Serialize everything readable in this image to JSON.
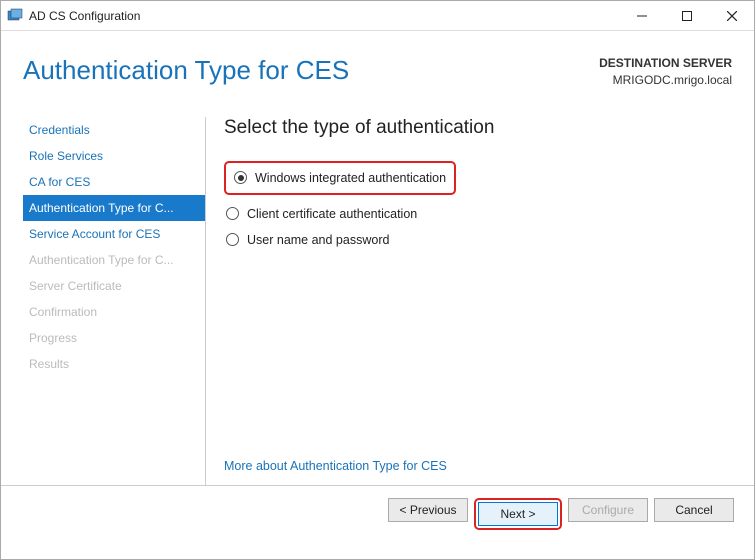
{
  "window": {
    "title": "AD CS Configuration"
  },
  "header": {
    "title": "Authentication Type for CES",
    "dest_label": "DESTINATION SERVER",
    "dest_value": "MRIGODC.mrigo.local"
  },
  "sidebar": {
    "items": [
      {
        "label": "Credentials",
        "state": "link"
      },
      {
        "label": "Role Services",
        "state": "link"
      },
      {
        "label": "CA for CES",
        "state": "link"
      },
      {
        "label": "Authentication Type for C...",
        "state": "selected"
      },
      {
        "label": "Service Account for CES",
        "state": "link"
      },
      {
        "label": "Authentication Type for C...",
        "state": "disabled"
      },
      {
        "label": "Server Certificate",
        "state": "disabled"
      },
      {
        "label": "Confirmation",
        "state": "disabled"
      },
      {
        "label": "Progress",
        "state": "disabled"
      },
      {
        "label": "Results",
        "state": "disabled"
      }
    ]
  },
  "content": {
    "heading": "Select the type of authentication",
    "options": [
      {
        "label": "Windows integrated authentication",
        "checked": true
      },
      {
        "label": "Client certificate authentication",
        "checked": false
      },
      {
        "label": "User name and password",
        "checked": false
      }
    ],
    "more_link": "More about Authentication Type for CES"
  },
  "footer": {
    "previous": "< Previous",
    "next": "Next >",
    "configure": "Configure",
    "cancel": "Cancel"
  }
}
